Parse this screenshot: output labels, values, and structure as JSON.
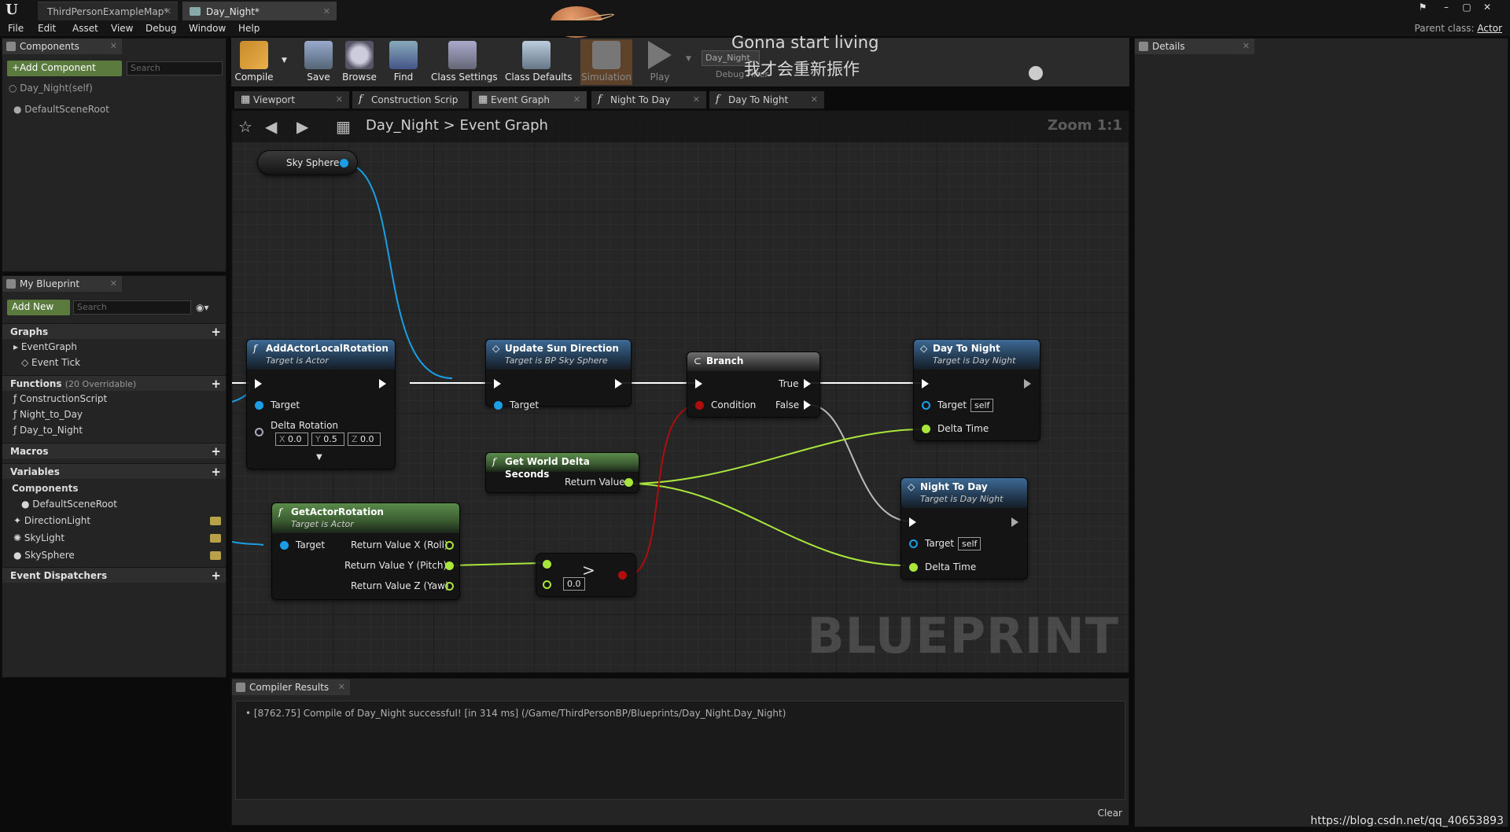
{
  "window": {
    "tabs": [
      {
        "label": "ThirdPersonExampleMap*"
      },
      {
        "label": "Day_Night*"
      }
    ],
    "parent_class_label": "Parent class:",
    "parent_class_value": "Actor"
  },
  "menu": [
    "File",
    "Edit",
    "Asset",
    "View",
    "Debug",
    "Window",
    "Help"
  ],
  "components_panel": {
    "tab": "Components",
    "add_button": "+Add Component",
    "search_placeholder": "Search",
    "items": [
      "Day_Night(self)",
      "DefaultSceneRoot"
    ]
  },
  "my_blueprint": {
    "tab": "My Blueprint",
    "add_new": "Add New",
    "search_placeholder": "Search",
    "sections": {
      "graphs": "Graphs",
      "functions": "Functions",
      "functions_count": "(20 Overridable)",
      "macros": "Macros",
      "variables": "Variables",
      "event_dispatchers": "Event Dispatchers"
    },
    "graphs_items": [
      "EventGraph",
      "Event Tick"
    ],
    "function_items": [
      "ConstructionScript",
      "Night_to_Day",
      "Day_to_Night"
    ],
    "variables_group": "Components",
    "variable_items": [
      "DefaultSceneRoot",
      "DirectionLight",
      "SkyLight",
      "SkySphere"
    ]
  },
  "toolbar": {
    "compile": "Compile",
    "save": "Save",
    "browse": "Browse",
    "find": "Find",
    "class_settings": "Class Settings",
    "class_defaults": "Class Defaults",
    "simulation": "Simulation",
    "play": "Play",
    "debug_object": "Day_Night",
    "debug_filter": "Debug Filter",
    "overlay_line1": "Gonna start living",
    "overlay_line2": "我才会重新振作"
  },
  "graph_tabs": [
    "Viewport",
    "Construction Scrip",
    "Event Graph",
    "Night To Day",
    "Day To Night"
  ],
  "graph": {
    "breadcrumb_root": "Day_Night",
    "breadcrumb_sep": ">",
    "breadcrumb_leaf": "Event Graph",
    "zoom": "Zoom 1:1",
    "watermark": "BLUEPRINT",
    "nodes": {
      "sky_sphere": "Sky Sphere",
      "add_rot": {
        "title": "AddActorLocalRotation",
        "sub": "Target is Actor",
        "target": "Target",
        "delta": "Delta Rotation",
        "x_label": "X",
        "x": "0.0",
        "y_label": "Y",
        "y": "0.5",
        "z_label": "Z",
        "z": "0.0"
      },
      "update_sun": {
        "title": "Update Sun Direction",
        "sub": "Target is BP Sky Sphere",
        "target": "Target"
      },
      "branch": {
        "title": "Branch",
        "condition": "Condition",
        "true": "True",
        "false": "False"
      },
      "day_to_night": {
        "title": "Day To Night",
        "sub": "Target is Day Night",
        "target": "Target",
        "self": "self",
        "delta": "Delta Time"
      },
      "night_to_day": {
        "title": "Night To Day",
        "sub": "Target is Day Night",
        "target": "Target",
        "self": "self",
        "delta": "Delta Time"
      },
      "world_delta": {
        "title": "Get World Delta Seconds",
        "ret": "Return Value"
      },
      "get_rot": {
        "title": "GetActorRotation",
        "sub": "Target is Actor",
        "target": "Target",
        "rx": "Return Value X (Roll)",
        "ry": "Return Value Y (Pitch)",
        "rz": "Return Value Z (Yaw)"
      },
      "compare": {
        "value": "0.0",
        "op": ">"
      }
    }
  },
  "details": {
    "tab": "Details"
  },
  "compiler": {
    "tab": "Compiler Results",
    "message": "[8762.75] Compile of Day_Night successful! [in 314 ms] (/Game/ThirdPersonBP/Blueprints/Day_Night.Day_Night)",
    "clear": "Clear"
  },
  "watermark_url": "https://blog.csdn.net/qq_40653893",
  "colors": {
    "exec": "#ffffff",
    "object_pin": "#1a9fe6",
    "float_pin": "#a8e63c",
    "bool_pin": "#b00d0d"
  }
}
